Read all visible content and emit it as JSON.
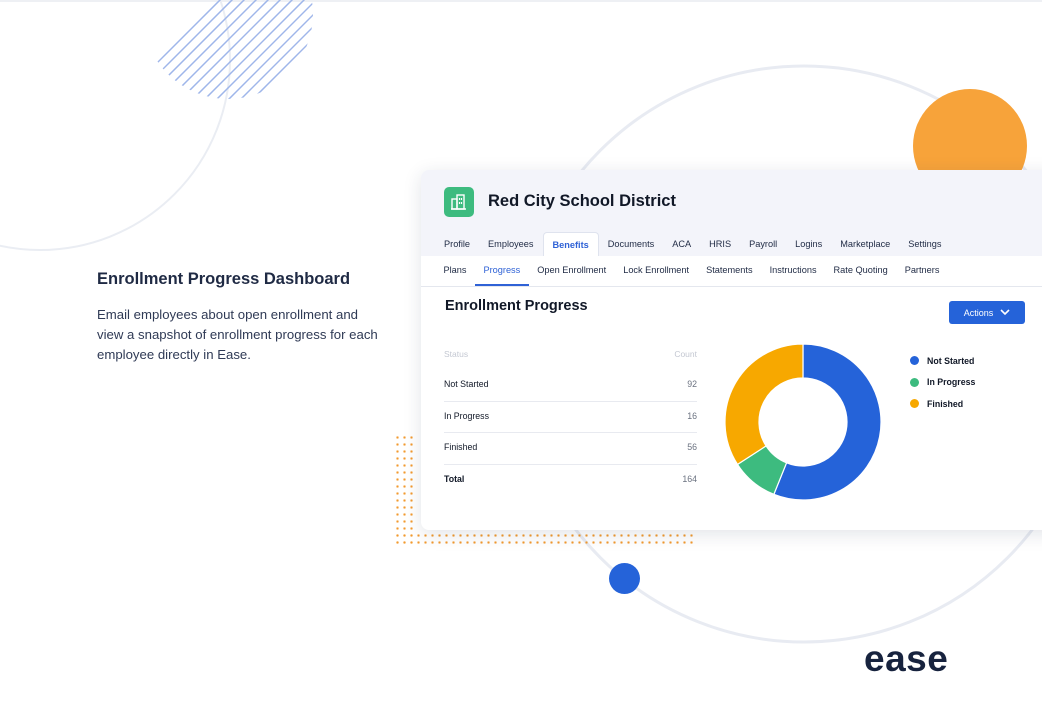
{
  "intro": {
    "title": "Enrollment Progress Dashboard",
    "description": "Email employees about open enrollment and view a snapshot of enrollment progress for each employee directly in Ease."
  },
  "app": {
    "district_name": "Red City School District",
    "logo_icon": "building-icon",
    "tabs": [
      {
        "label": "Profile"
      },
      {
        "label": "Employees"
      },
      {
        "label": "Benefits",
        "active": true
      },
      {
        "label": "Documents"
      },
      {
        "label": "ACA"
      },
      {
        "label": "HRIS"
      },
      {
        "label": "Payroll"
      },
      {
        "label": "Logins"
      },
      {
        "label": "Marketplace"
      },
      {
        "label": "Settings"
      }
    ],
    "subnav": [
      {
        "label": "Plans"
      },
      {
        "label": "Progress",
        "active": true
      },
      {
        "label": "Open Enrollment"
      },
      {
        "label": "Lock Enrollment"
      },
      {
        "label": "Statements"
      },
      {
        "label": "Instructions"
      },
      {
        "label": "Rate Quoting"
      },
      {
        "label": "Partners"
      }
    ]
  },
  "section": {
    "title": "Enrollment Progress",
    "actions_label": "Actions"
  },
  "table": {
    "header": {
      "status": "Status",
      "count": "Count"
    },
    "rows": [
      {
        "status": "Not Started",
        "count": "92"
      },
      {
        "status": "In Progress",
        "count": "16"
      },
      {
        "status": "Finished",
        "count": "56"
      }
    ],
    "total": {
      "status": "Total",
      "count": "164"
    }
  },
  "chart_data": {
    "type": "pie",
    "variant": "donut",
    "categories": [
      "Not Started",
      "In Progress",
      "Finished"
    ],
    "values": [
      92,
      16,
      56
    ],
    "colors": [
      "#2563d9",
      "#3dbb7f",
      "#f7a800"
    ],
    "legend_position": "right"
  },
  "colors": {
    "accent": "#2563d9",
    "brand_green": "#3dbb7f",
    "orange": "#f7a33a"
  },
  "brand": "ease"
}
